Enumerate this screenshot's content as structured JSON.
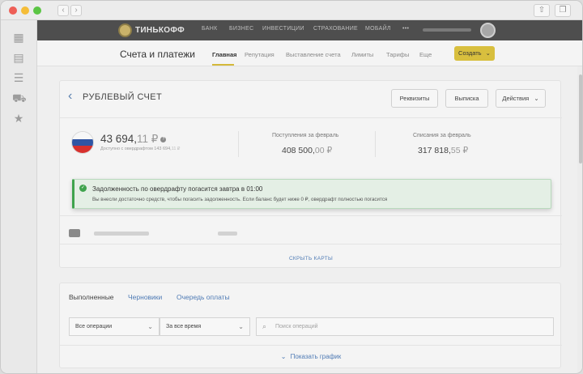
{
  "browser": {
    "nav_back": "‹",
    "nav_forward": "›",
    "share_icon": "share-icon",
    "tabs_icon": "tabs-icon"
  },
  "colors": {
    "accent_yellow": "#d8bf3e",
    "link_blue": "#4f7bb5",
    "success_green": "#3fa34d",
    "topnav_bg": "#4e4e4e"
  },
  "left_sidebar": {
    "icons": [
      "dashboard-icon",
      "calculator-icon",
      "tasks-settings-icon",
      "car-icon",
      "star-icon"
    ]
  },
  "top_nav": {
    "logo_text": "ТИНЬКОФФ",
    "items": [
      "БАНК",
      "БИЗНЕС",
      "ИНВЕСТИЦИИ",
      "СТРАХОВАНИЕ",
      "МОБАЙЛ"
    ],
    "more": "•••"
  },
  "sub_nav": {
    "title": "Счета и платежи",
    "items": [
      "Главная",
      "Репутация",
      "Выставление счета",
      "Лимиты",
      "Тарифы",
      "Еще"
    ],
    "active_index": 0,
    "create_button": "Создать",
    "create_chevron": "⌄"
  },
  "account": {
    "back": "‹",
    "title": "РУБЛЕВЫЙ СЧЕТ",
    "buttons": {
      "requisites": "Реквизиты",
      "statement": "Выписка",
      "actions": "Действия"
    },
    "actions_chevron": "⌄",
    "balance_main": "43 694,",
    "balance_kop": "11 ₽",
    "info": "?",
    "available_label": "Доступно с овердрафтом  143 694,",
    "available_kop": "11 ₽",
    "income_label": "Поступления за февраль",
    "income_main": "408 500,",
    "income_kop": "00 ₽",
    "expense_label": "Списания за февраль",
    "expense_main": "317 818,",
    "expense_kop": "55 ₽",
    "hide_cards": "СКРЫТЬ КАРТЫ"
  },
  "alert": {
    "check": "✓",
    "title": "Задолженность по овердрафту погасится завтра в 01:00",
    "text": "Вы внесли достаточно средств, чтобы погасить задолженность. Если баланс будет ниже 0 ₽, овердрафт полностью погасится"
  },
  "operations": {
    "tabs": [
      "Выполненные",
      "Черновики",
      "Очередь оплаты"
    ],
    "filter_type": "Все операции",
    "filter_period": "За все время",
    "search_placeholder": "Поиск операций",
    "chevron": "⌄",
    "search_icon": "⌕",
    "show_chart": "Показать график",
    "show_chart_chevron": "⌄"
  }
}
